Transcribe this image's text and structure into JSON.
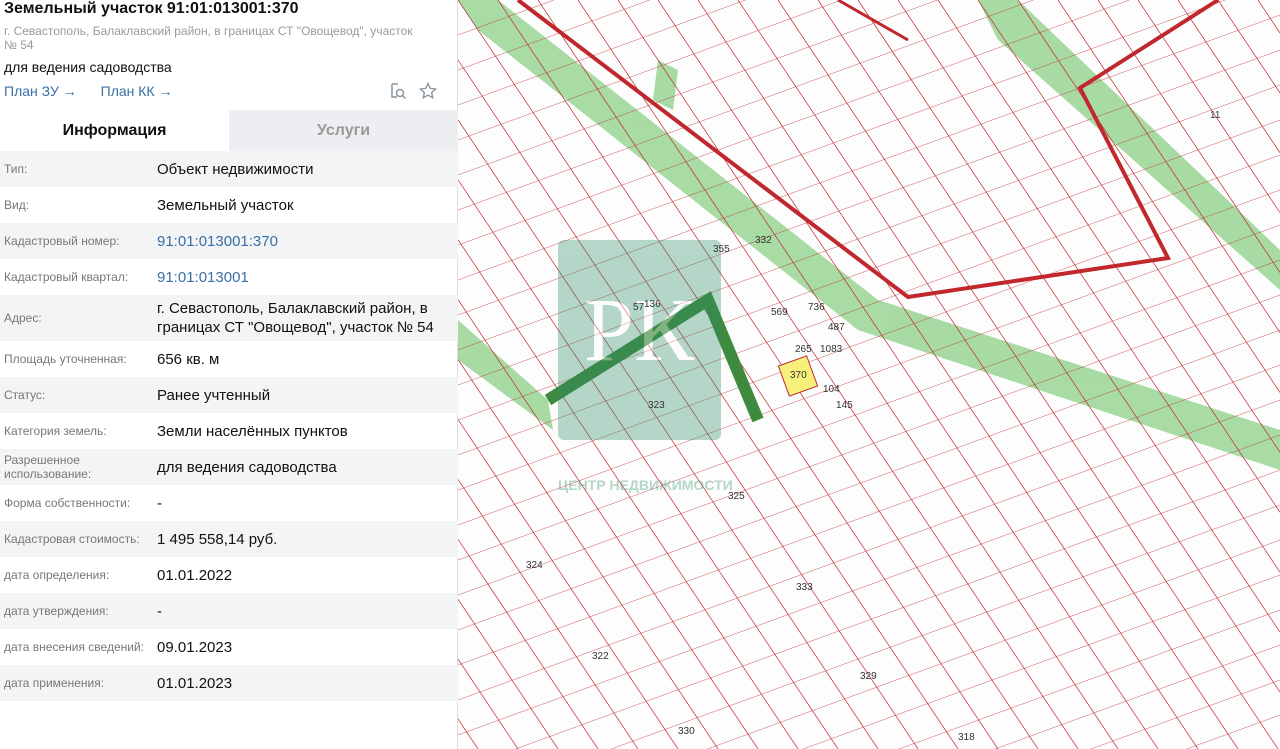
{
  "header": {
    "title": "Земельный участок 91:01:013001:370",
    "address": "г. Севастополь, Балаклавский район, в границах СТ \"Овощевод\", участок № 54",
    "use": "для ведения садоводства",
    "plan_zu": "План ЗУ →",
    "plan_kk": "План КК →"
  },
  "tabs": [
    {
      "label": "Информация"
    },
    {
      "label": "Услуги"
    }
  ],
  "rows": [
    {
      "label": "Тип:",
      "value": "Объект недвижимости"
    },
    {
      "label": "Вид:",
      "value": "Земельный участок"
    },
    {
      "label": "Кадастровый номер:",
      "value": "91:01:013001:370"
    },
    {
      "label": "Кадастровый квартал:",
      "value": "91:01:013001"
    },
    {
      "label": "Адрес:",
      "value": "г. Севастополь, Балаклавский район, в границах СТ \"Овощевод\", участок № 54"
    },
    {
      "label": "Площадь уточненная:",
      "value": "656 кв. м"
    },
    {
      "label": "Статус:",
      "value": "Ранее учтенный"
    },
    {
      "label": "Категория земель:",
      "value": "Земли населённых пунктов"
    },
    {
      "label": "Разрешенное использование:",
      "value": "для ведения садоводства"
    },
    {
      "label": "Форма собственности:",
      "value": "-"
    },
    {
      "label": "Кадастровая стоимость:",
      "value": "1 495 558,14 руб."
    },
    {
      "label": "дата определения:",
      "value": "01.01.2022"
    },
    {
      "label": "дата утверждения:",
      "value": "-"
    },
    {
      "label": "дата внесения сведений:",
      "value": "09.01.2023"
    },
    {
      "label": "дата применения:",
      "value": "01.01.2023"
    }
  ],
  "map": {
    "parcels": [
      "370",
      "323",
      "325",
      "324",
      "333",
      "322",
      "329",
      "330",
      "318",
      "11",
      "265",
      "104",
      "145",
      "1083",
      "487",
      "736",
      "569",
      "332",
      "355",
      "136",
      "57"
    ],
    "watermark": "ЦЕНТР НЕДВИЖИМОСТИ",
    "colors": {
      "boundary": "#c0282d",
      "green": "#9fd89a",
      "highlight": "#f7f07a"
    }
  }
}
